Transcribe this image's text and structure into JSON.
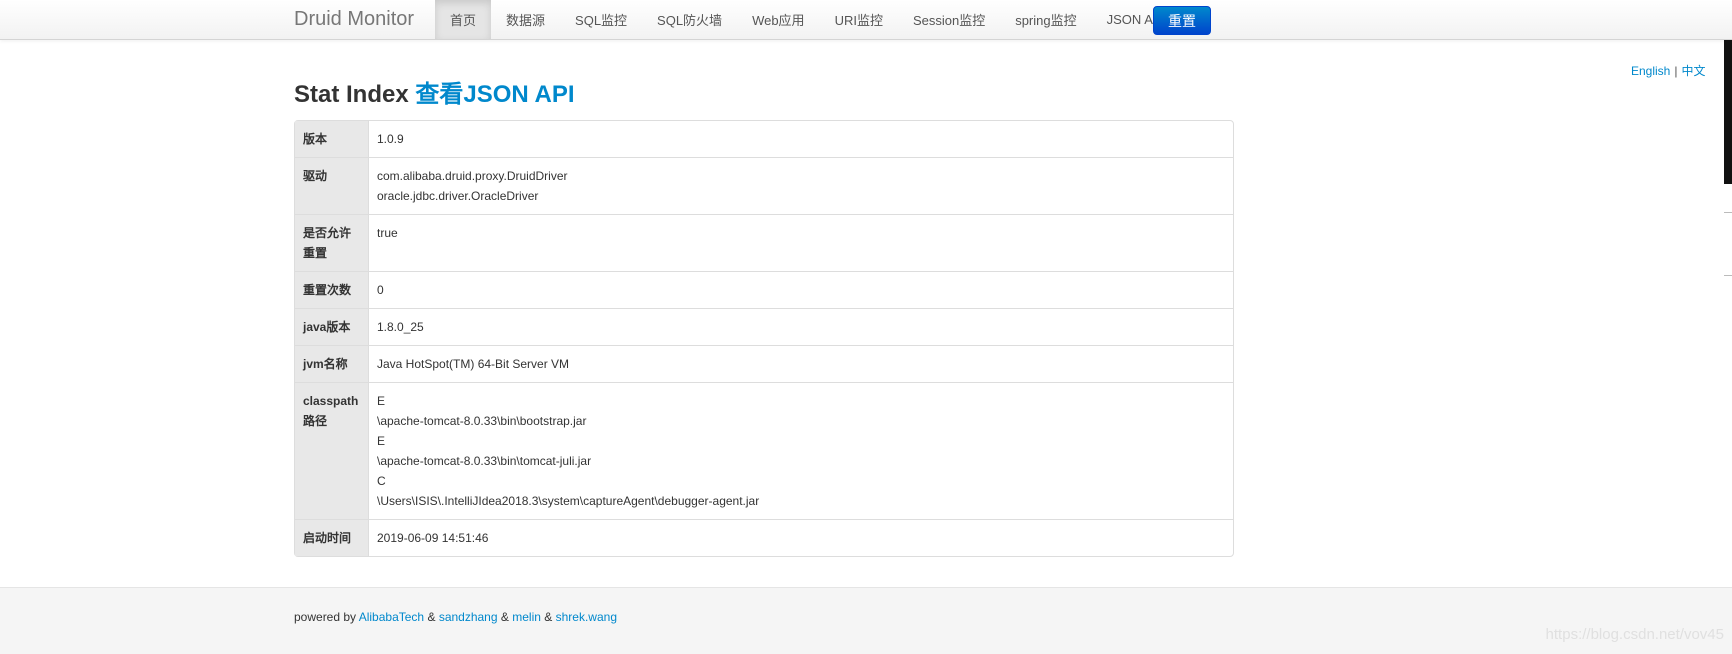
{
  "navbar": {
    "brand": "Druid Monitor",
    "items": [
      {
        "label": "首页",
        "active": true
      },
      {
        "label": "数据源"
      },
      {
        "label": "SQL监控"
      },
      {
        "label": "SQL防火墙"
      },
      {
        "label": "Web应用"
      },
      {
        "label": "URI监控"
      },
      {
        "label": "Session监控"
      },
      {
        "label": "spring监控"
      },
      {
        "label": "JSON API"
      }
    ],
    "reset_label": "重置"
  },
  "lang": {
    "english": "English",
    "separator": "|",
    "chinese": "中文"
  },
  "title": {
    "text": "Stat Index",
    "link": "查看JSON API"
  },
  "stats": [
    {
      "key": "版本",
      "value": "1.0.9"
    },
    {
      "key": "驱动",
      "lines": [
        "com.alibaba.druid.proxy.DruidDriver",
        "oracle.jdbc.driver.OracleDriver"
      ]
    },
    {
      "key_lines": [
        "是否允许",
        "重置"
      ],
      "value": "true"
    },
    {
      "key": "重置次数",
      "value": "0"
    },
    {
      "key": "java版本",
      "value": "1.8.0_25"
    },
    {
      "key": "jvm名称",
      "value": "Java HotSpot(TM) 64-Bit Server VM"
    },
    {
      "key_lines": [
        "classpath",
        "路径"
      ],
      "lines": [
        "E",
        "\\apache-tomcat-8.0.33\\bin\\bootstrap.jar",
        "E",
        "\\apache-tomcat-8.0.33\\bin\\tomcat-juli.jar",
        "C",
        "\\Users\\ISIS\\.IntelliJIdea2018.3\\system\\captureAgent\\debugger-agent.jar"
      ]
    },
    {
      "key": "启动时间",
      "value": "2019-06-09 14:51:46"
    }
  ],
  "footer": {
    "powered_by": "powered by",
    "links": [
      "AlibabaTech",
      "sandzhang",
      "melin",
      "shrek.wang"
    ],
    "amp": "&",
    "watermark": "https://blog.csdn.net/vov45"
  },
  "colors": {
    "link": "#0088cc",
    "button": "#0044cc",
    "key_cell": "#e8e8e8"
  }
}
